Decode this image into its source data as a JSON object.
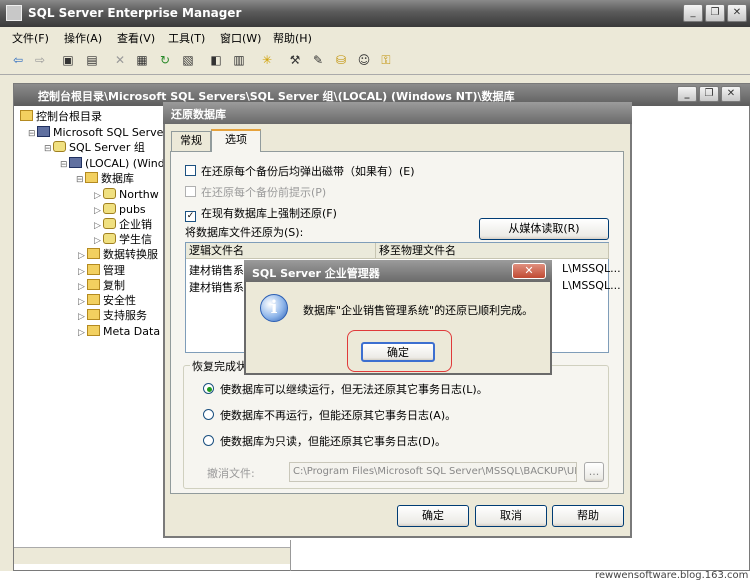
{
  "app": {
    "title": "SQL Server Enterprise Manager"
  },
  "menu": [
    "文件(F)",
    "操作(A)",
    "查看(V)",
    "工具(T)",
    "窗口(W)",
    "帮助(H)"
  ],
  "window_controls": {
    "minimize": "_",
    "restore": "❐",
    "close": "✕"
  },
  "toolbar_icons": [
    "back-arrow-icon",
    "forward-arrow-icon",
    "up-folder-icon",
    "tree-toggle-icon",
    "delete-icon",
    "properties-icon",
    "refresh-icon",
    "export-icon",
    "view-icon",
    "wizard-icon",
    "run-icon",
    "new-database-icon",
    "new-login-icon"
  ],
  "child": {
    "title": "控制台根目录\\Microsoft SQL Servers\\SQL Server 组\\(LOCAL) (Windows NT)\\数据库"
  },
  "tree": {
    "root": "控制台根目录",
    "servers": "Microsoft SQL Servers",
    "group": "SQL Server 组",
    "local": "(LOCAL) (Wind",
    "databases": "数据库",
    "db_items": [
      "Northw",
      "pubs",
      "企业销",
      "学生信"
    ],
    "other_items": [
      "数据转换服",
      "管理",
      "复制",
      "安全性",
      "支持服务",
      "Meta Data"
    ]
  },
  "restore_dialog": {
    "title": "还原数据库",
    "tabs": [
      "常规",
      "选项"
    ],
    "options": [
      {
        "label": "在还原每个备份后均弹出磁带（如果有）(E)",
        "checked": false,
        "enabled": true
      },
      {
        "label": "在还原每个备份前提示(P)",
        "checked": false,
        "enabled": false
      },
      {
        "label": "在现有数据库上强制还原(F)",
        "checked": true,
        "enabled": true
      }
    ],
    "restore_as_label": "将数据库文件还原为(S):",
    "read_from_media_button": "从媒体读取(R)",
    "columns": [
      "逻辑文件名",
      "移至物理文件名"
    ],
    "rows": [
      [
        "建材销售系",
        "L\\MSSQL..."
      ],
      [
        "建材销售系",
        "L\\MSSQL..."
      ]
    ],
    "recovery_group": "恢复完成状",
    "recovery_options": [
      {
        "label": "使数据库可以继续运行，但无法还原其它事务日志(L)。",
        "selected": true
      },
      {
        "label": "使数据库不再运行，但能还原其它事务日志(A)。",
        "selected": false
      },
      {
        "label": "使数据库为只读，但能还原其它事务日志(D)。",
        "selected": false
      }
    ],
    "undo_file_label": "撤消文件:",
    "undo_file_value": "C:\\Program Files\\Microsoft SQL Server\\MSSQL\\BACKUP\\UN",
    "browse_label": "...",
    "ok": "确定",
    "cancel": "取消",
    "help": "帮助"
  },
  "message_box": {
    "title": "SQL Server 企业管理器",
    "message": "数据库\"企业销售管理系统\"的还原已顺利完成。",
    "ok": "确定",
    "icon": "i",
    "close": "✕"
  },
  "watermark": "rewwensoftware.blog.163.com"
}
